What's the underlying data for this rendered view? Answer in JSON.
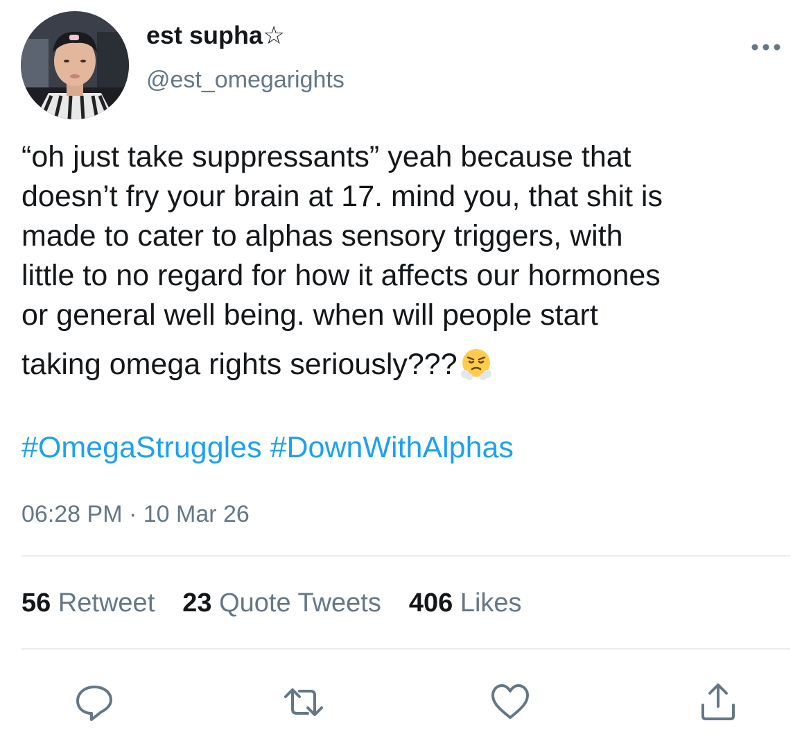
{
  "author": {
    "display_name": "est supha☆",
    "handle": "@est_omegarights"
  },
  "tweet": {
    "lines": [
      "“oh just take suppressants” yeah because that",
      "doesn’t fry your brain at 17. mind you, that shit is",
      "made to cater to alphas sensory triggers, with",
      "little to no regard for how it affects our hormones",
      "or general well being. when will people start",
      "taking omega rights seriously???"
    ],
    "emoji": "face-with-steam-from-nose",
    "hashtags": [
      "#OmegaStruggles",
      "#DownWithAlphas"
    ],
    "timestamp": "06:28 PM · 10 Mar 26"
  },
  "stats": {
    "retweets": {
      "count": "56",
      "label": "Retweet"
    },
    "quotes": {
      "count": "23",
      "label": "Quote Tweets"
    },
    "likes": {
      "count": "406",
      "label": "Likes"
    }
  },
  "icons": {
    "more": "more-dots-icon",
    "reply": "reply-icon",
    "retweet": "retweet-icon",
    "like": "heart-icon",
    "share": "share-icon"
  },
  "colors": {
    "link": "#1da1f2",
    "secondary_text": "#657786",
    "primary_text": "#14171a",
    "divider": "#e6ecf0"
  }
}
